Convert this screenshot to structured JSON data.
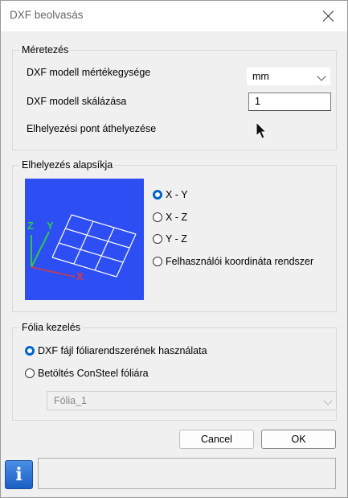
{
  "window": {
    "title": "DXF beolvasás",
    "close_icon": "close-icon"
  },
  "dimensions": {
    "group_label": "Méretezés",
    "unit_label": "DXF modell mértékegysége",
    "unit_value": "mm",
    "scale_label": "DXF modell skálázása",
    "scale_value": "1",
    "move_point_label": "Elhelyezési pont áthelyezése"
  },
  "placement": {
    "group_label": "Elhelyezés alapsíkja",
    "preview": {
      "axis_x": "X",
      "axis_y": "Y",
      "axis_z": "Z",
      "background_color": "#2d4ef3"
    },
    "options": [
      {
        "label": "X - Y",
        "checked": true
      },
      {
        "label": "X - Z",
        "checked": false
      },
      {
        "label": "Y - Z",
        "checked": false
      },
      {
        "label": "Felhasználói koordináta rendszer",
        "checked": false
      }
    ]
  },
  "layers": {
    "group_label": "Fólia kezelés",
    "options": [
      {
        "label": "DXF fájl fóliarendszerének használata",
        "checked": true
      },
      {
        "label": "Betöltés ConSteel fóliára",
        "checked": false
      }
    ],
    "layer_select_value": "Fólia_1"
  },
  "buttons": {
    "cancel": "Cancel",
    "ok": "OK"
  },
  "info": {
    "icon": "info-icon",
    "icon_glyph": "i",
    "status_text": ""
  },
  "colors": {
    "accent": "#0064c8",
    "preview_bg": "#2d4ef3"
  }
}
